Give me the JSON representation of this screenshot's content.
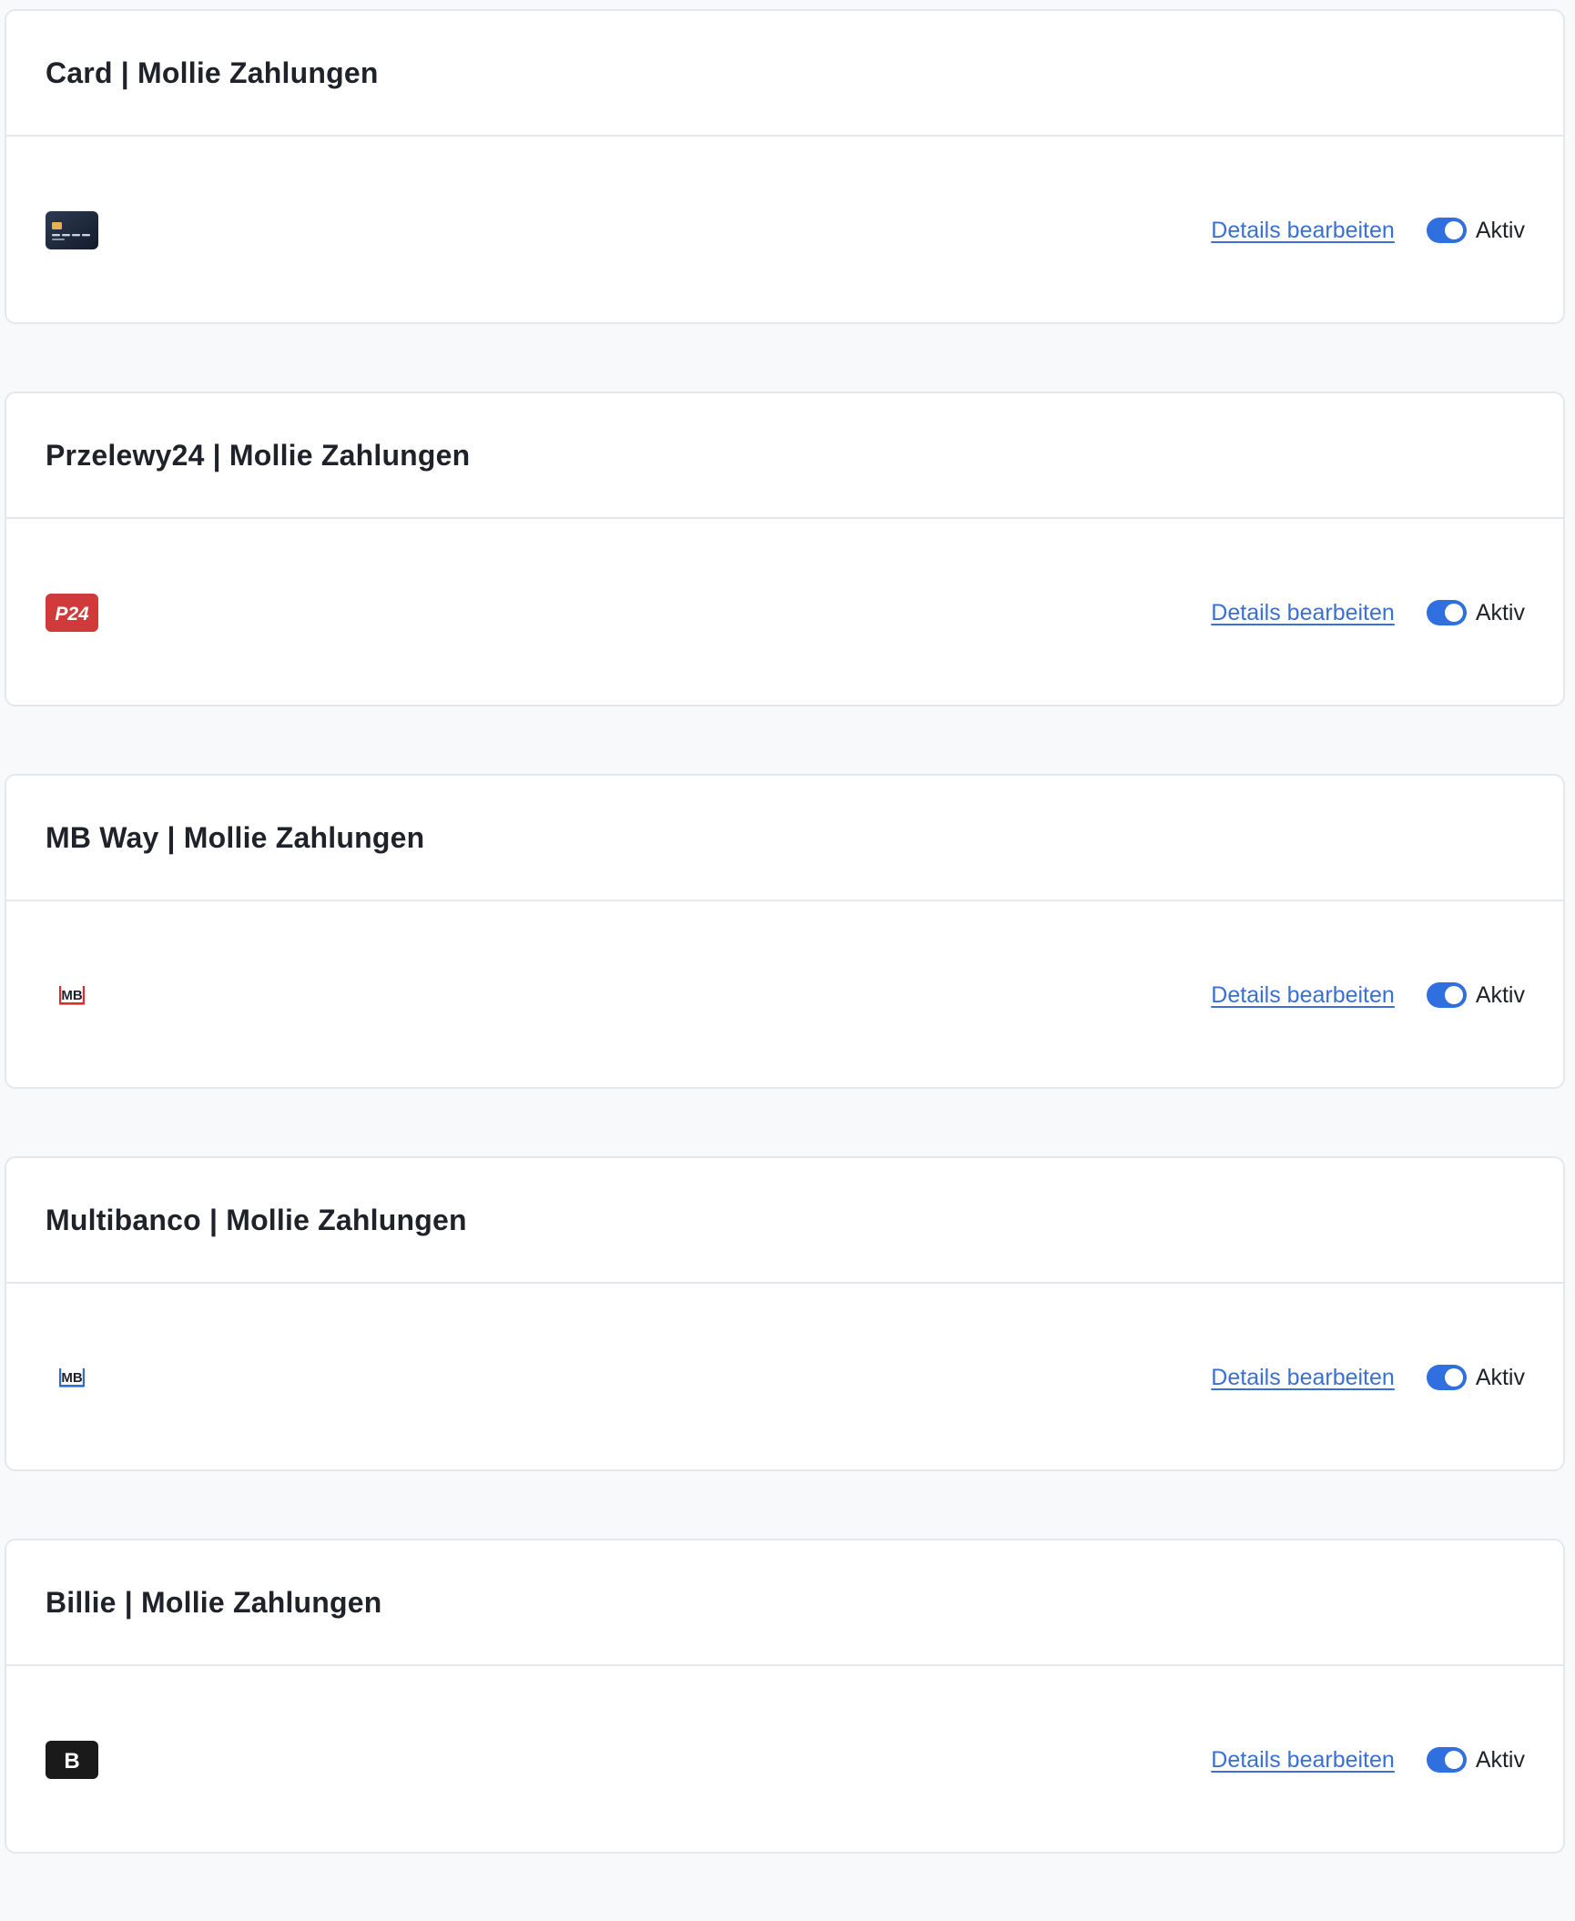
{
  "colors": {
    "accent": "#2f6fe0",
    "link": "#3b6fd4",
    "border": "#e5e7eb",
    "background": "#f8f9fb"
  },
  "payment_methods": [
    {
      "title": "Card | Mollie Zahlungen",
      "logo_icon": "credit-card-icon",
      "details_label": "Details bearbeiten",
      "status_label": "Aktiv",
      "active": true
    },
    {
      "title": "Przelewy24 | Mollie Zahlungen",
      "logo_icon": "p24-logo-icon",
      "logo_text": "P24",
      "details_label": "Details bearbeiten",
      "status_label": "Aktiv",
      "active": true
    },
    {
      "title": "MB Way | Mollie Zahlungen",
      "logo_icon": "mb-way-logo-icon",
      "logo_text": "MB",
      "details_label": "Details bearbeiten",
      "status_label": "Aktiv",
      "active": true
    },
    {
      "title": "Multibanco | Mollie Zahlungen",
      "logo_icon": "multibanco-logo-icon",
      "logo_text": "MB",
      "details_label": "Details bearbeiten",
      "status_label": "Aktiv",
      "active": true
    },
    {
      "title": "Billie | Mollie Zahlungen",
      "logo_icon": "billie-logo-icon",
      "logo_text": "B",
      "details_label": "Details bearbeiten",
      "status_label": "Aktiv",
      "active": true
    }
  ]
}
